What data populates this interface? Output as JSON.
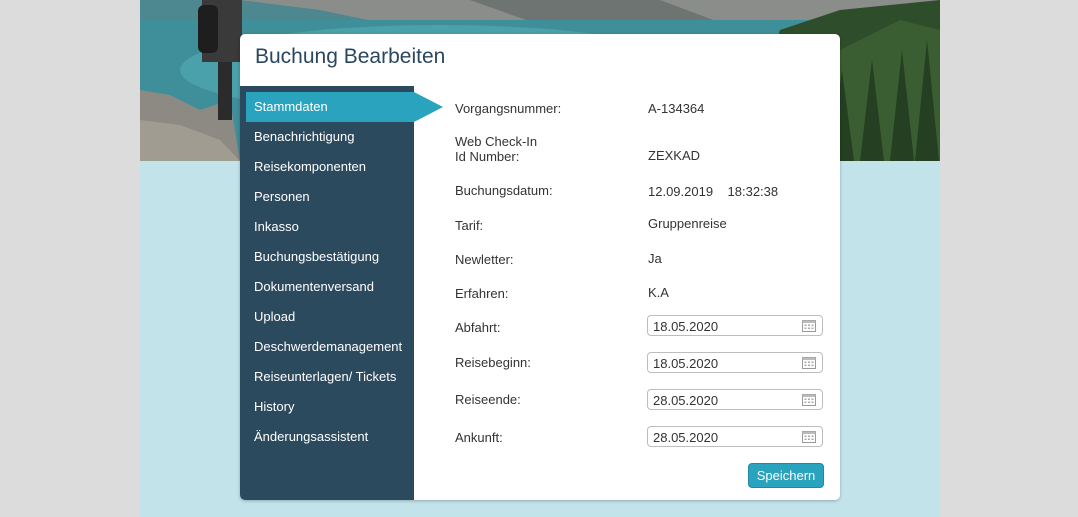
{
  "page_title": "Buchung Bearbeiten",
  "sidebar": {
    "items": [
      {
        "label": "Stammdaten",
        "active": true
      },
      {
        "label": "Benachrichtigung"
      },
      {
        "label": "Reisekomponenten"
      },
      {
        "label": "Personen"
      },
      {
        "label": "Inkasso"
      },
      {
        "label": "Buchungsbestätigung"
      },
      {
        "label": "Dokumentenversand"
      },
      {
        "label": "Upload"
      },
      {
        "label": "Deschwerdemanagement"
      },
      {
        "label": "Reiseunterlagen/ Tickets"
      },
      {
        "label": "History"
      },
      {
        "label": "Änderungsassistent"
      }
    ]
  },
  "fields": {
    "vorgangsnummer": {
      "label": "Vorgangsnummer:",
      "value": "A-134364"
    },
    "webcheckin": {
      "label_line1": "Web Check-In",
      "label_line2": "Id Number:",
      "value": "ZEXKAD"
    },
    "buchungsdatum": {
      "label": "Buchungsdatum:",
      "value": "12.09.2019    18:32:38"
    },
    "tarif": {
      "label": "Tarif:",
      "value": "Gruppenreise"
    },
    "newletter": {
      "label": "Newletter:",
      "value": "Ja"
    },
    "erfahren": {
      "label": "Erfahren:",
      "value": "K.A"
    },
    "abfahrt": {
      "label": "Abfahrt:",
      "value": "18.05.2020"
    },
    "reisebeginn": {
      "label": "Reisebeginn:",
      "value": "18.05.2020"
    },
    "reiseende": {
      "label": "Reiseende:",
      "value": "28.05.2020"
    },
    "ankunft": {
      "label": "Ankunft:",
      "value": "28.05.2020"
    }
  },
  "save_label": "Speichern",
  "colors": {
    "accent": "#2aa3bf",
    "sidebar_bg": "#2c4a5e",
    "title": "#2a4760",
    "page_bg": "#c2e3ea"
  },
  "icons": {
    "date": "calendar-icon"
  }
}
